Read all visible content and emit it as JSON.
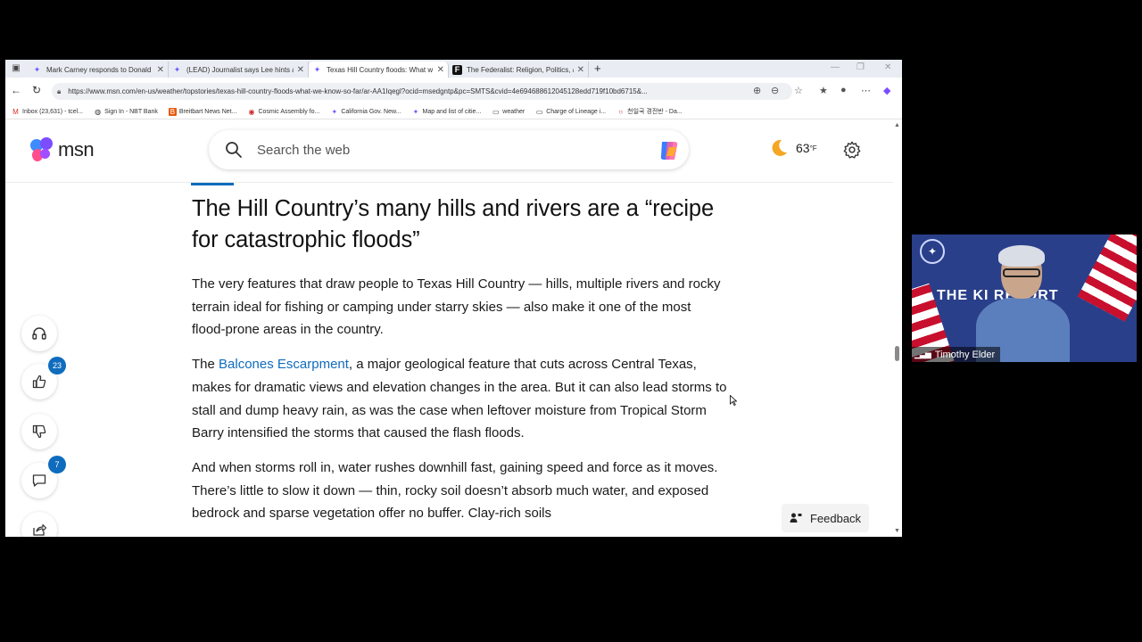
{
  "browser": {
    "tabs": [
      {
        "title": "Mark Carney responds to Donald",
        "favicon": "msn"
      },
      {
        "title": "(LEAD) Journalist says Lee hints at",
        "favicon": "msn"
      },
      {
        "title": "Texas Hill Country floods: What w",
        "favicon": "msn",
        "active": true
      },
      {
        "title": "The Federalist: Religion, Politics, a",
        "favicon": "federalist"
      }
    ],
    "url": "https://www.msn.com/en-us/weather/topstories/texas-hill-country-floods-what-we-know-so-far/ar-AA1Iqegl?ocid=msedgntp&pc=SMTS&cvid=4e694688612045128edd719f10bd6715&...",
    "bookmarks": [
      {
        "label": "Inbox (23,631) - tcel...",
        "icon": "gmail-icon"
      },
      {
        "label": "Sign In - NBT Bank",
        "icon": "globe-icon"
      },
      {
        "label": "Breitbart News Net...",
        "icon": "breitbart-icon"
      },
      {
        "label": "Cosmic Assembly fo...",
        "icon": "cosmic-icon"
      },
      {
        "label": "California Gov. New...",
        "icon": "msn-icon"
      },
      {
        "label": "Map and list of citie...",
        "icon": "msn-icon"
      },
      {
        "label": "weather",
        "icon": "folder-icon"
      },
      {
        "label": "Charge of Lineage i...",
        "icon": "folder-icon"
      },
      {
        "label": "천일국 경전반 - Da...",
        "icon": "circle-icon"
      }
    ]
  },
  "header": {
    "logo_text": "msn",
    "search_placeholder": "Search the web",
    "temperature": "63",
    "temp_unit": "°F"
  },
  "rail": {
    "like_count": "23",
    "comment_count": "7"
  },
  "article": {
    "heading": "The Hill Country’s many hills and rivers are a “recipe for catastrophic floods”",
    "p1": "The very features that draw people to Texas Hill Country — hills, multiple rivers and rocky terrain ideal for fishing or camping under starry skies — also make it one of the most flood-prone areas in the country.",
    "p2_prefix": "The ",
    "p2_link": "Balcones Escarpment",
    "p2_rest": ", a major geological feature that cuts across Central Texas, makes for dramatic views and elevation changes in the area. But it can also lead storms to stall and dump heavy rain, as was the case when leftover moisture from Tropical Storm Barry intensified the storms that caused the flash floods.",
    "p3": "And when storms roll in, water rushes downhill fast, gaining speed and force as it moves. There’s little to slow it down — thin, rocky soil doesn’t absorb much water, and exposed bedrock and sparse vegetation offer no buffer. Clay-rich soils"
  },
  "feedback_label": "Feedback",
  "webcam": {
    "banner": "THE KI     REPORT",
    "participant_name": "Timothy Elder"
  },
  "colors": {
    "accent": "#0f6cbd",
    "badge": "#0f6cbd"
  }
}
